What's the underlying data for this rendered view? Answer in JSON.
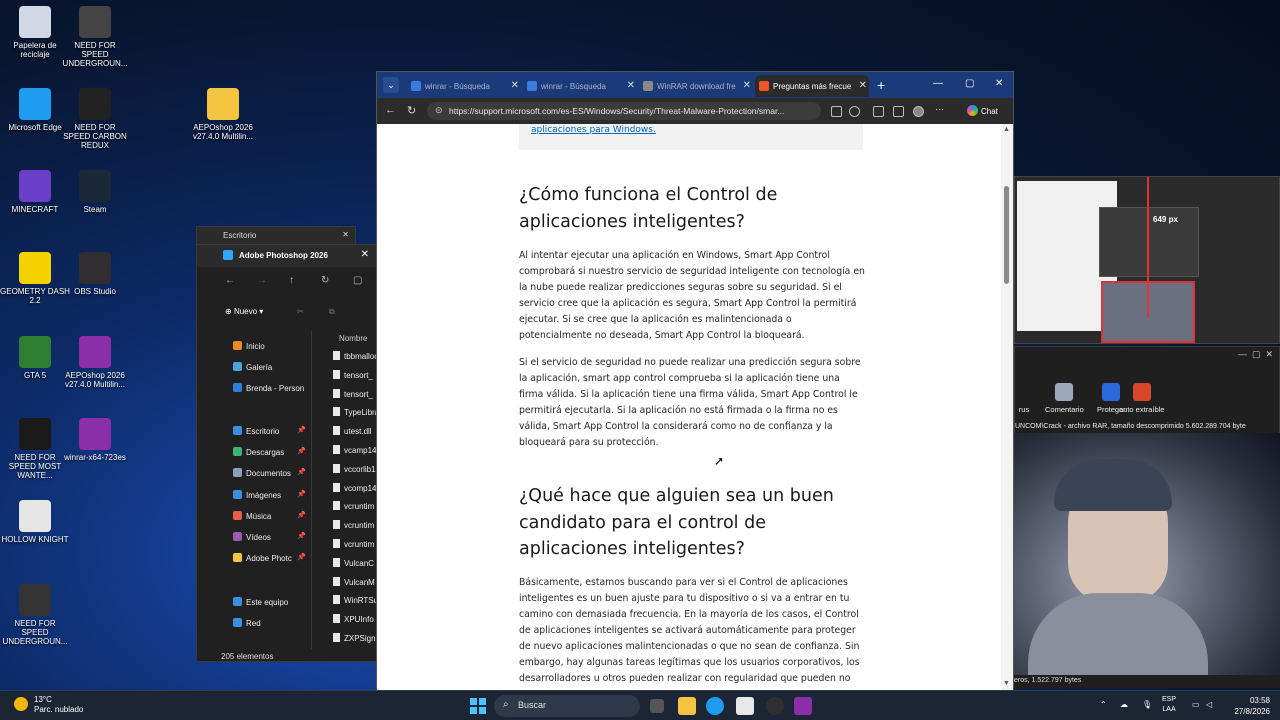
{
  "desktop": {
    "icons": [
      {
        "label": "Papelera de reciclaje",
        "icon": "recycle-bin-icon",
        "color": "#cfd8e3"
      },
      {
        "label": "NEED FOR SPEED UNDERGROUN...",
        "icon": "nfs-icon",
        "color": "#444444"
      },
      {
        "label": "Microsoft Edge",
        "icon": "edge-icon",
        "color": "#1f9cf0"
      },
      {
        "label": "NEED FOR SPEED CARBON REDUX",
        "icon": "nfs-carbon-icon",
        "color": "#222222"
      },
      {
        "label": "AEPOshop 2026 v27.4.0 Multilin...",
        "icon": "folder-icon",
        "color": "#f4c542"
      },
      {
        "label": "MINECRAFT",
        "icon": "minecraft-icon",
        "color": "#6a3fc8"
      },
      {
        "label": "Steam",
        "icon": "steam-icon",
        "color": "#1b2838"
      },
      {
        "label": "GEOMETRY DASH 2.2",
        "icon": "geometry-dash-icon",
        "color": "#f5d300"
      },
      {
        "label": "OBS Studio",
        "icon": "obs-icon",
        "color": "#302e31"
      },
      {
        "label": "GTA 5",
        "icon": "gta-icon",
        "color": "#2e7d32"
      },
      {
        "label": "AEPOshop 2026 v27.4.0 Multilin...",
        "icon": "winrar-icon",
        "color": "#8b2fa8"
      },
      {
        "label": "NEED FOR SPEED MOST WANTE...",
        "icon": "nfs-mw-icon",
        "color": "#1a1a1a"
      },
      {
        "label": "winrar-x64-723es",
        "icon": "winrar-icon",
        "color": "#8b2fa8"
      },
      {
        "label": "HOLLOW KNIGHT",
        "icon": "hollow-knight-icon",
        "color": "#e6e6e6"
      },
      {
        "label": "NEED FOR SPEED UNDERGROUN...",
        "icon": "nfs-u-icon",
        "color": "#333333"
      }
    ]
  },
  "explorer": {
    "back_tab": "Escritorio",
    "title": "Adobe Photoshop 2026",
    "new_button": "Nuevo",
    "column_header": "Nombre",
    "sidebar": [
      {
        "label": "Inicio",
        "color": "#f08a24"
      },
      {
        "label": "Galería",
        "color": "#4aa3df"
      },
      {
        "label": "Brenda - Person",
        "color": "#2f7fd8"
      },
      {
        "label": "Escritorio",
        "color": "#3a8ee6"
      },
      {
        "label": "Descargas",
        "color": "#3bb371"
      },
      {
        "label": "Documentos",
        "color": "#8aa0b8"
      },
      {
        "label": "Imágenes",
        "color": "#3a8ee6"
      },
      {
        "label": "Música",
        "color": "#e85d4a"
      },
      {
        "label": "Vídeos",
        "color": "#9b59b6"
      },
      {
        "label": "Adobe Photc",
        "color": "#f4c542"
      },
      {
        "label": "Este equipo",
        "color": "#3a8ee6"
      },
      {
        "label": "Red",
        "color": "#3a8ee6"
      }
    ],
    "files": [
      "tbbmalloc",
      "tensort_",
      "tensort_",
      "TypeLibra",
      "utest.dll",
      "vcamp14",
      "vccorlib1",
      "vcomp14",
      "vcruntim",
      "vcruntim",
      "vcruntim",
      "VulcanC",
      "VulcanM",
      "WinRTSu",
      "XPUInfo",
      "ZXPSignL"
    ],
    "status": "205 elementos"
  },
  "browser": {
    "tabs": [
      {
        "label": "winrar - Búsqueda",
        "active": false,
        "fav": "#3b7be0"
      },
      {
        "label": "winrar - Búsqueda",
        "active": false,
        "fav": "#3b7be0"
      },
      {
        "label": "WinRAR download fre",
        "active": false,
        "fav": "#888888"
      },
      {
        "label": "Preguntas más frecue",
        "active": true,
        "fav": "#f35325"
      }
    ],
    "url": "https://support.microsoft.com/es-ES/Windows/Security/Threat-Malware-Protection/smar...",
    "chat_label": "Chat",
    "content": {
      "note_link": "aplicaciones para Windows.",
      "heading1": "¿Cómo funciona el Control de aplicaciones inteligentes?",
      "para1": "Al intentar ejecutar una aplicación en Windows, Smart App Control comprobará si nuestro servicio de seguridad inteligente con tecnología en la nube puede realizar predicciones seguras sobre su seguridad. Si el servicio cree que la aplicación es segura, Smart App Control la permitirá ejecutar. Si se cree que la aplicación es malintencionada o potencialmente no deseada, Smart App Control la bloqueará.",
      "para2": "Si el servicio de seguridad no puede realizar una predicción segura sobre la aplicación, smart app control comprueba si la aplicación tiene una firma válida. Si la aplicación tiene una firma válida, Smart App Control le permitirá ejecutarla. Si la aplicación no está firmada o la firma no es válida, Smart App Control la considerará como no de confianza y la bloqueará para su protección.",
      "heading2": "¿Qué hace que alguien sea un buen candidato para el control de aplicaciones inteligentes?",
      "para3": "Básicamente, estamos buscando para ver si el Control de aplicaciones inteligentes es un buen ajuste para tu dispositivo o si va a entrar en tu camino con demasiada frecuencia. En la mayoría de los casos, el Control de aplicaciones inteligentes se activará automáticamente para proteger de nuevo aplicaciones malintencionadas o que no sean de confianza. Sin embargo, hay algunas tareas legítimas que los usuarios corporativos, los desarrolladores u otros pueden realizar con regularidad que pueden no"
    }
  },
  "background_windows": {
    "thumb_label": "649 px",
    "winrar_toolbar": [
      {
        "label": "rus",
        "color": "#888888"
      },
      {
        "label": "Comentario",
        "color": "#9aa8b8"
      },
      {
        "label": "Proteger",
        "color": "#2a6ad8"
      },
      {
        "label": "auto extraíble",
        "color": "#d8452a"
      }
    ],
    "winrar_title": "UNCOM\\Crack - archivo RAR, tamaño descomprimido 5.602.289.704 byte",
    "winrar_status": "eros, 1.522.797 bytes"
  },
  "taskbar": {
    "weather_temp": "13°C",
    "weather_desc": "Parc. nublado",
    "search_placeholder": "Buscar",
    "lang_top": "ESP",
    "lang_bottom": "LAA",
    "time": "03:58",
    "date": "27/8/2026"
  }
}
